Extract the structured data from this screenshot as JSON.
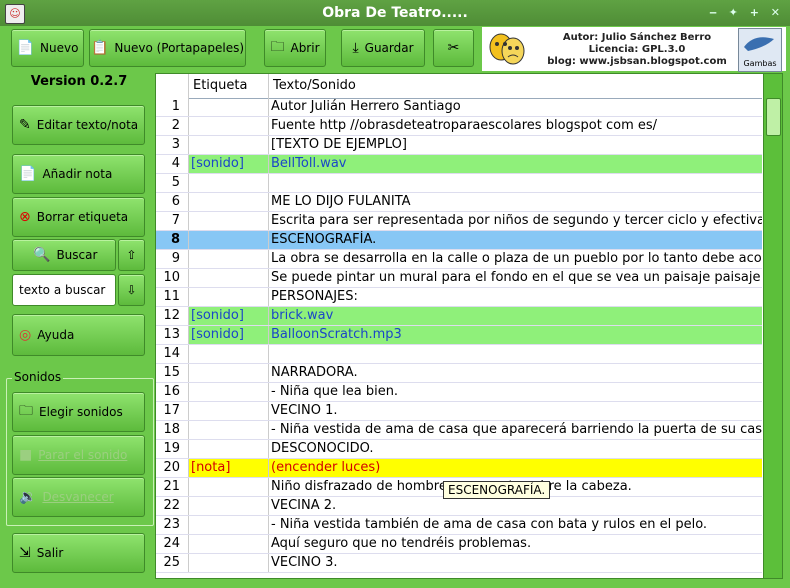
{
  "window": {
    "title": "Obra De Teatro....."
  },
  "toolbar": {
    "nuevo": "Nuevo",
    "nuevo_portapapeles": "Nuevo (Portapapeles)",
    "abrir": "Abrir",
    "guardar": "Guardar"
  },
  "logo": {
    "autor": "Autor: Julio Sánchez Berro",
    "licencia": "Licencia: GPL.3.0",
    "blog": "blog: www.jsbsan.blogspot.com",
    "gambas": "Gambas"
  },
  "sidebar": {
    "version": "Version 0.2.7",
    "editar": "Editar texto/nota",
    "anadir": "Añadir nota",
    "borrar": "Borrar etiqueta",
    "buscar": "Buscar",
    "search_value": "texto a buscar",
    "ayuda": "Ayuda",
    "sonidos_label": "Sonidos",
    "elegir": "Elegir sonidos",
    "parar": "Parar el sonido",
    "desvanecer": "Desvanecer",
    "salir": "Salir"
  },
  "grid": {
    "headers": [
      "Etiqueta",
      "Texto/Sonido"
    ],
    "rows": [
      {
        "n": "1",
        "tag": "",
        "text": "Autor Julián Herrero Santiago",
        "kind": ""
      },
      {
        "n": "2",
        "tag": "",
        "text": "Fuente http //obrasdeteatroparaescolares blogspot com es/",
        "kind": ""
      },
      {
        "n": "3",
        "tag": "",
        "text": "[TEXTO DE EJEMPLO]",
        "kind": ""
      },
      {
        "n": "4",
        "tag": "[sonido]",
        "text": "BellToll.wav",
        "kind": "snd"
      },
      {
        "n": "5",
        "tag": "",
        "text": "",
        "kind": ""
      },
      {
        "n": "6",
        "tag": "",
        "text": "ME LO DIJO FULANITA",
        "kind": ""
      },
      {
        "n": "7",
        "tag": "",
        "text": "Escrita para ser representada por niños de segundo y tercer ciclo y efectivamente",
        "kind": ""
      },
      {
        "n": "8",
        "tag": "",
        "text": "ESCENOGRAFÍA.",
        "kind": "sel"
      },
      {
        "n": "9",
        "tag": "",
        "text": "La obra se desarrolla en la calle o plaza de un pueblo por lo tanto debe acondicionarse",
        "kind": ""
      },
      {
        "n": "10",
        "tag": "",
        "text": " Se puede pintar un mural para el fondo en el que se vea un paisaje paisaje urbano",
        "kind": ""
      },
      {
        "n": "11",
        "tag": "",
        "text": "PERSONAJES:",
        "kind": ""
      },
      {
        "n": "12",
        "tag": "[sonido]",
        "text": "brick.wav",
        "kind": "snd"
      },
      {
        "n": "13",
        "tag": "[sonido]",
        "text": "BalloonScratch.mp3",
        "kind": "snd"
      },
      {
        "n": "14",
        "tag": "",
        "text": "",
        "kind": ""
      },
      {
        "n": "15",
        "tag": "",
        "text": "NARRADORA.",
        "kind": ""
      },
      {
        "n": "16",
        "tag": "",
        "text": " - Niña que lea bien.",
        "kind": ""
      },
      {
        "n": "17",
        "tag": "",
        "text": "VECINO 1.",
        "kind": ""
      },
      {
        "n": "18",
        "tag": "",
        "text": " - Niña vestida de ama de casa que aparecerá barriendo la puerta de su casa",
        "kind": ""
      },
      {
        "n": "19",
        "tag": "",
        "text": "DESCONOCIDO.",
        "kind": ""
      },
      {
        "n": "20",
        "tag": "[nota]",
        "text": "(encender luces)",
        "kind": "nota"
      },
      {
        "n": "21",
        "tag": "",
        "text": " Niño disfrazado de hombre                una manta sobre la cabeza.",
        "kind": ""
      },
      {
        "n": "22",
        "tag": "",
        "text": "VECINA 2.",
        "kind": ""
      },
      {
        "n": "23",
        "tag": "",
        "text": " - Niña vestida también de ama de casa con bata y rulos en el pelo.",
        "kind": ""
      },
      {
        "n": "24",
        "tag": "",
        "text": " Aquí seguro que no tendréis problemas.",
        "kind": ""
      },
      {
        "n": "25",
        "tag": "",
        "text": "VECINO 3.",
        "kind": ""
      }
    ]
  },
  "tooltip": "ESCENOGRAFÍA.",
  "icons": {
    "app": "theater-app-icon",
    "tools": "tools-icon",
    "masks": "theater-masks-icon"
  }
}
